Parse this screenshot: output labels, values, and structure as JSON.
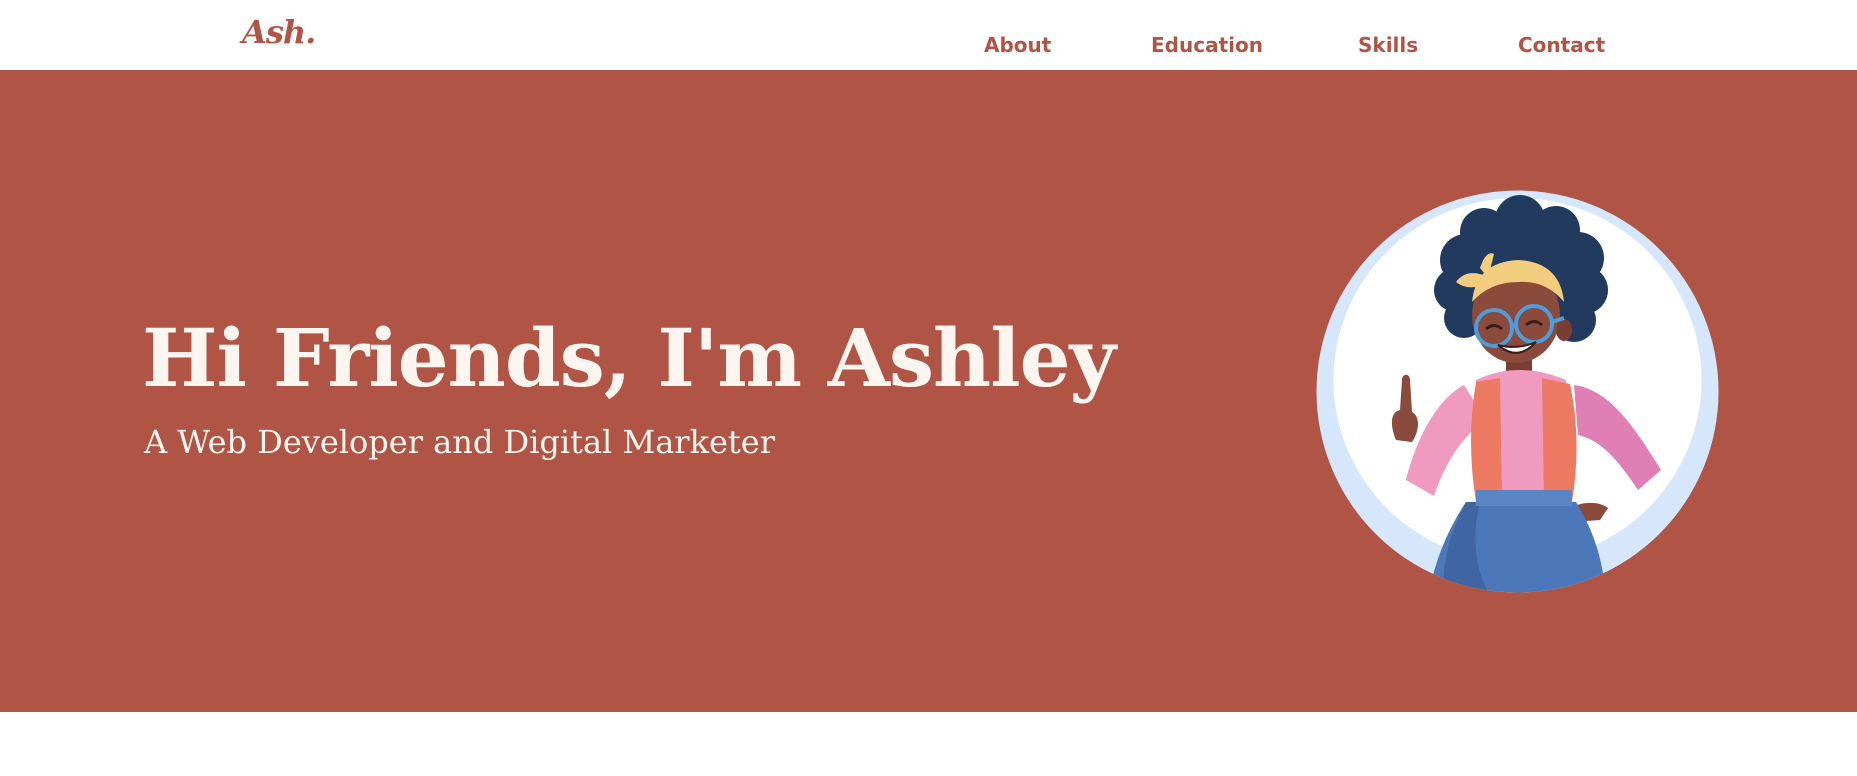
{
  "nav": {
    "logo": "Ash.",
    "links": [
      "About",
      "Education",
      "Skills",
      "Contact"
    ]
  },
  "hero": {
    "title": "Hi Friends, I'm Ashley",
    "subtitle": "A Web Developer and Digital Marketer",
    "avatar_icon": "woman-pointing-illustration"
  },
  "colors": {
    "brand": "#b05546",
    "hero_text": "#fdf6f0",
    "avatar_ring": "#d6e7fb"
  }
}
